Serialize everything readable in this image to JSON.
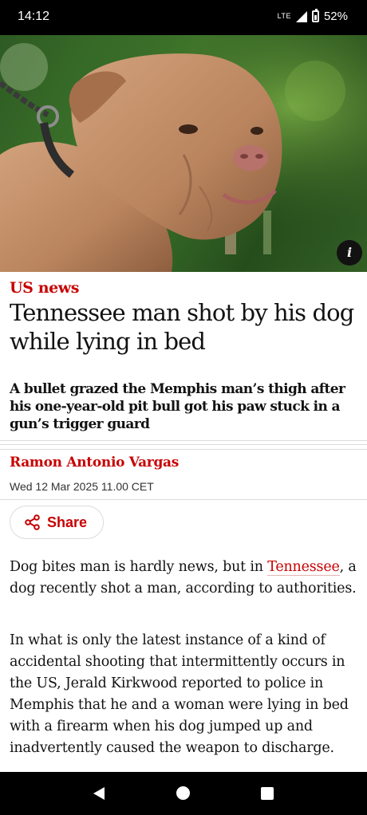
{
  "status_bar": {
    "time": "14:12",
    "network": "LTE",
    "battery": "52%"
  },
  "hero_image": {
    "info_label": "i"
  },
  "article": {
    "section": "US news",
    "headline": "Tennessee man shot by his dog while lying in bed",
    "standfirst": "A bullet grazed the Memphis man’s thigh after his one-year-old pit bull got his paw stuck in a gun’s trigger guard",
    "byline": "Ramon Antonio Vargas",
    "date": "Wed 12 Mar 2025 11.00 CET",
    "share_label": "Share",
    "paragraph_1": {
      "before_link": "Dog bites man is hardly news, but in ",
      "link_text": "Tennessee",
      "after_link": ", a dog recently shot a man, according to authorities."
    },
    "paragraph_2": "In what is only the latest instance of a kind of accidental shooting that intermittently occurs in the US, Jerald Kirkwood reported to police in Memphis that he and a woman were lying in bed with a firearm when his dog jumped up and inadvertently caused the weapon to discharge."
  },
  "colors": {
    "accent": "#c70000",
    "text": "#121212",
    "divider": "#dcdcdc"
  }
}
